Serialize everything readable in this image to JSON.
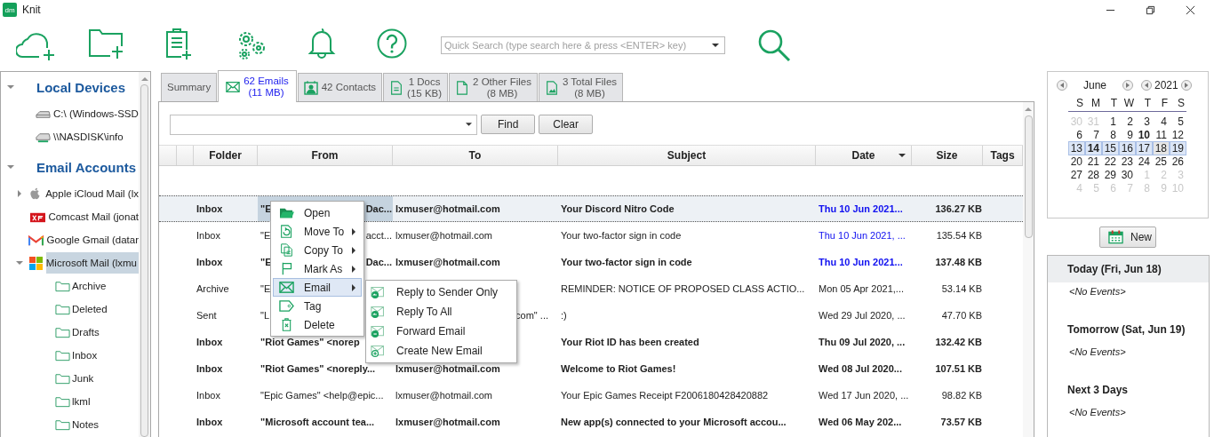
{
  "window": {
    "logo_text": "dm",
    "title": "Knit"
  },
  "toolbar": {
    "search": {
      "placeholder": "Quick Search (type search here & press <ENTER> key)"
    }
  },
  "sidebar": {
    "sections": [
      {
        "label": "Local Devices",
        "expanded": true,
        "children": [
          {
            "kind": "drive",
            "label": "C:\\ (Windows-SSD",
            "selected": false
          },
          {
            "kind": "network",
            "label": "\\\\NASDISK\\info",
            "selected": false
          }
        ]
      },
      {
        "label": "Email Accounts",
        "expanded": true,
        "children": [
          {
            "kind": "apple",
            "label": "Apple iCloud Mail (lx",
            "expanded": false,
            "selected": false
          },
          {
            "kind": "comcast",
            "label": "Comcast Mail (jonat",
            "selected": false
          },
          {
            "kind": "gmail",
            "label": "Google Gmail (datar",
            "selected": false
          },
          {
            "kind": "microsoft",
            "label": "Microsoft Mail (lxmu",
            "expanded": true,
            "selected": true,
            "children": [
              {
                "label": "Archive",
                "selected": false
              },
              {
                "label": "Deleted",
                "selected": false
              },
              {
                "label": "Drafts",
                "selected": false
              },
              {
                "label": "Inbox",
                "selected": false
              },
              {
                "label": "Junk",
                "selected": false
              },
              {
                "label": "lkml",
                "selected": false
              },
              {
                "label": "Notes",
                "selected": false
              }
            ]
          }
        ]
      }
    ]
  },
  "tabs": [
    {
      "kind": "summary",
      "lines": [
        "Summary"
      ],
      "selected": false
    },
    {
      "kind": "emails",
      "lines": [
        "62 Emails",
        "(11 MB)"
      ],
      "selected": true
    },
    {
      "kind": "contacts",
      "lines": [
        "42 Contacts"
      ],
      "selected": false
    },
    {
      "kind": "docs",
      "lines": [
        "1 Docs",
        "(15 KB)"
      ],
      "selected": false
    },
    {
      "kind": "files",
      "lines": [
        "2 Other Files",
        "(8 MB)"
      ],
      "selected": false
    },
    {
      "kind": "images",
      "lines": [
        "3 Total Files",
        "(8 MB)"
      ],
      "selected": false
    }
  ],
  "filter": {
    "find_button": "Find",
    "clear_button": "Clear"
  },
  "table": {
    "columns": [
      {
        "label": "Folder",
        "sorted": false
      },
      {
        "label": "From",
        "sorted": false
      },
      {
        "label": "To",
        "sorted": false
      },
      {
        "label": "Subject",
        "sorted": false
      },
      {
        "label": "Date",
        "sorted": true
      },
      {
        "label": "Size",
        "sorted": false
      },
      {
        "label": "Tags",
        "sorted": false
      }
    ],
    "rows": [
      {
        "folder": "Inbox",
        "from": {
          "start": "\"E",
          "end": "Dac..."
        },
        "to": "lxmuser@hotmail.com",
        "subject": "Your Discord Nitro Code",
        "date": "Thu 10 Jun 2021...",
        "size": "136.27 KB",
        "unread": true,
        "recent": true,
        "selected": true
      },
      {
        "folder": "Inbox",
        "from": {
          "start": "\"E",
          "end": "acct..."
        },
        "to": "lxmuser@hotmail.com",
        "subject": "Your two-factor sign in code",
        "date": "Thu 10 Jun 2021, ...",
        "size": "135.54 KB",
        "unread": false,
        "recent": true,
        "selected": false
      },
      {
        "folder": "Inbox",
        "from": {
          "start": "\"E",
          "end": "Dac..."
        },
        "to": "lxmuser@hotmail.com",
        "subject": "Your two-factor sign in code",
        "date": "Thu 10 Jun 2021...",
        "size": "137.48 KB",
        "unread": true,
        "recent": true,
        "selected": false
      },
      {
        "folder": "Archive",
        "from": {
          "start": "\"E"
        },
        "subject": "REMINDER: NOTICE OF PROPOSED CLASS ACTIO...",
        "date": "Mon 05 Apr 2021,...",
        "size": "53.14 KB",
        "unread": false,
        "recent": false,
        "selected": false
      },
      {
        "folder": "Sent",
        "from": {
          "start": "\"L"
        },
        "to": {
          "end": "com\" ..."
        },
        "subject": ":)",
        "date": "Wed 29 Jul 2020, ...",
        "size": "47.70 KB",
        "unread": false,
        "recent": false,
        "selected": false
      },
      {
        "folder": "Inbox",
        "from": "\"Riot Games\" <norep",
        "subject": "Your Riot ID has been created",
        "date": "Thu 09 Jul 2020, ...",
        "size": "132.42 KB",
        "unread": true,
        "recent": false,
        "selected": false
      },
      {
        "folder": "Inbox",
        "from": "\"Riot Games\" <noreply...",
        "to": "lxmuser@hotmail.com",
        "subject": "Welcome to Riot Games!",
        "date": "Wed 08 Jul 2020...",
        "size": "107.51 KB",
        "unread": true,
        "recent": false,
        "selected": false
      },
      {
        "folder": "Inbox",
        "from": "\"Epic Games\" <help@epic...",
        "to": "lxmuser@hotmail.com",
        "subject": "Your Epic Games Receipt F2006180428420882",
        "date": "Wed 17 Jun 2020, ...",
        "size": "98.82 KB",
        "unread": false,
        "recent": false,
        "selected": false
      },
      {
        "folder": "Inbox",
        "from": "\"Microsoft account tea...",
        "to": "lxmuser@hotmail.com",
        "subject": "New app(s) connected to your Microsoft accou...",
        "date": "Wed 06 May 202...",
        "size": "73.57 KB",
        "unread": true,
        "recent": false,
        "selected": false
      }
    ]
  },
  "context_menu": {
    "items": [
      {
        "kind": "open",
        "label": "Open",
        "has_submenu": false,
        "selected": false
      },
      {
        "kind": "move",
        "label": "Move To",
        "has_submenu": true,
        "selected": false
      },
      {
        "kind": "copy",
        "label": "Copy To",
        "has_submenu": true,
        "selected": false
      },
      {
        "kind": "flag",
        "label": "Mark As",
        "has_submenu": true,
        "selected": false
      },
      {
        "kind": "email",
        "label": "Email",
        "has_submenu": true,
        "selected": true
      },
      {
        "kind": "tag",
        "label": "Tag",
        "has_submenu": false,
        "selected": false
      },
      {
        "kind": "delete",
        "label": "Delete",
        "has_submenu": false,
        "selected": false
      }
    ],
    "submenu": [
      {
        "kind": "reply",
        "label": "Reply to Sender Only"
      },
      {
        "kind": "reply",
        "label": "Reply To All"
      },
      {
        "kind": "forward",
        "label": "Forward Email"
      },
      {
        "kind": "new",
        "label": "Create New Email"
      }
    ]
  },
  "calendar": {
    "month": "June",
    "year": "2021",
    "weekdays": [
      "S",
      "M",
      "T",
      "W",
      "T",
      "F",
      "S"
    ],
    "weeks": [
      [
        {
          "day": "30",
          "other_month": true,
          "has_events": false,
          "selected": false,
          "today": false
        },
        {
          "day": "31",
          "other_month": true,
          "has_events": false,
          "selected": false,
          "today": false
        },
        {
          "day": "1",
          "other_month": false,
          "has_events": false,
          "selected": false,
          "today": false
        },
        {
          "day": "2",
          "other_month": false,
          "has_events": false,
          "selected": false,
          "today": false
        },
        {
          "day": "3",
          "other_month": false,
          "has_events": false,
          "selected": false,
          "today": false
        },
        {
          "day": "4",
          "other_month": false,
          "has_events": false,
          "selected": false,
          "today": false
        },
        {
          "day": "5",
          "other_month": false,
          "has_events": false,
          "selected": false,
          "today": false
        }
      ],
      [
        {
          "day": "6",
          "other_month": false,
          "has_events": false,
          "selected": false,
          "today": false
        },
        {
          "day": "7",
          "other_month": false,
          "has_events": false,
          "selected": false,
          "today": false
        },
        {
          "day": "8",
          "other_month": false,
          "has_events": false,
          "selected": false,
          "today": false
        },
        {
          "day": "9",
          "other_month": false,
          "has_events": false,
          "selected": false,
          "today": false
        },
        {
          "day": "10",
          "other_month": false,
          "has_events": true,
          "selected": false,
          "today": false
        },
        {
          "day": "11",
          "other_month": false,
          "has_events": false,
          "selected": false,
          "today": false
        },
        {
          "day": "12",
          "other_month": false,
          "has_events": false,
          "selected": false,
          "today": false
        }
      ],
      [
        {
          "day": "13",
          "other_month": false,
          "has_events": false,
          "selected": true,
          "today": false
        },
        {
          "day": "14",
          "other_month": false,
          "has_events": true,
          "selected": true,
          "today": false
        },
        {
          "day": "15",
          "other_month": false,
          "has_events": false,
          "selected": true,
          "today": false
        },
        {
          "day": "16",
          "other_month": false,
          "has_events": false,
          "selected": true,
          "today": false
        },
        {
          "day": "17",
          "other_month": false,
          "has_events": false,
          "selected": true,
          "today": false
        },
        {
          "day": "18",
          "other_month": false,
          "has_events": false,
          "selected": true,
          "today": true
        },
        {
          "day": "19",
          "other_month": false,
          "has_events": false,
          "selected": true,
          "today": false
        }
      ],
      [
        {
          "day": "20",
          "other_month": false,
          "has_events": false,
          "selected": false,
          "today": false
        },
        {
          "day": "21",
          "other_month": false,
          "has_events": false,
          "selected": false,
          "today": false
        },
        {
          "day": "22",
          "other_month": false,
          "has_events": false,
          "selected": false,
          "today": false
        },
        {
          "day": "23",
          "other_month": false,
          "has_events": false,
          "selected": false,
          "today": false
        },
        {
          "day": "24",
          "other_month": false,
          "has_events": false,
          "selected": false,
          "today": false
        },
        {
          "day": "25",
          "other_month": false,
          "has_events": false,
          "selected": false,
          "today": false
        },
        {
          "day": "26",
          "other_month": false,
          "has_events": false,
          "selected": false,
          "today": false
        }
      ],
      [
        {
          "day": "27",
          "other_month": false,
          "has_events": false,
          "selected": false,
          "today": false
        },
        {
          "day": "28",
          "other_month": false,
          "has_events": false,
          "selected": false,
          "today": false
        },
        {
          "day": "29",
          "other_month": false,
          "has_events": false,
          "selected": false,
          "today": false
        },
        {
          "day": "30",
          "other_month": false,
          "has_events": false,
          "selected": false,
          "today": false
        },
        {
          "day": "1",
          "other_month": true,
          "has_events": false,
          "selected": false,
          "today": false
        },
        {
          "day": "2",
          "other_month": true,
          "has_events": false,
          "selected": false,
          "today": false
        },
        {
          "day": "3",
          "other_month": true,
          "has_events": false,
          "selected": false,
          "today": false
        }
      ],
      [
        {
          "day": "4",
          "other_month": true,
          "has_events": false,
          "selected": false,
          "today": false
        },
        {
          "day": "5",
          "other_month": true,
          "has_events": false,
          "selected": false,
          "today": false
        },
        {
          "day": "6",
          "other_month": true,
          "has_events": false,
          "selected": false,
          "today": false
        },
        {
          "day": "7",
          "other_month": true,
          "has_events": false,
          "selected": false,
          "today": false
        },
        {
          "day": "8",
          "other_month": true,
          "has_events": false,
          "selected": false,
          "today": false
        },
        {
          "day": "9",
          "other_month": true,
          "has_events": false,
          "selected": false,
          "today": false
        },
        {
          "day": "10",
          "other_month": true,
          "has_events": false,
          "selected": false,
          "today": false
        }
      ]
    ]
  },
  "new_button": "New",
  "agenda": [
    {
      "title": "Today (Fri, Jun 18)",
      "events": "<No Events>",
      "selected": true
    },
    {
      "title": "Tomorrow (Sat, Jun 19)",
      "events": "<No Events>",
      "selected": false
    },
    {
      "title": "Next 3 Days",
      "events": "<No Events>",
      "selected": false
    }
  ]
}
